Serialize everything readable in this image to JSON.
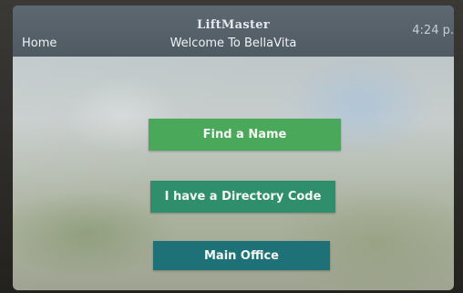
{
  "header": {
    "brand": "LiftMaster",
    "home_label": "Home",
    "welcome_text": "Welcome To BellaVita",
    "time": "4:24 p."
  },
  "buttons": {
    "find_name": "Find a Name",
    "directory_code": "I have a Directory Code",
    "main_office": "Main Office"
  },
  "colors": {
    "header_bg": "#56626a",
    "find_button": "#4aa85a",
    "code_button": "#2f8f6d",
    "office_button": "#1e7277"
  }
}
